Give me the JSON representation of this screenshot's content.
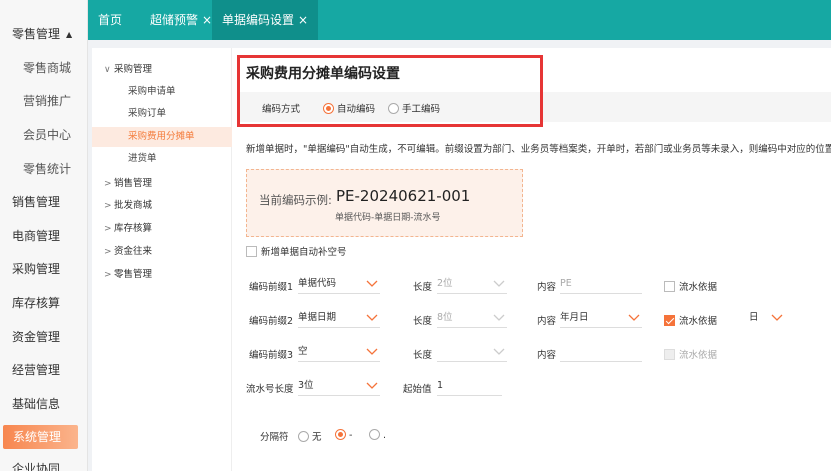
{
  "sidebar": {
    "items": [
      {
        "label": "零售管理",
        "expanded": true
      },
      {
        "label": "零售商城"
      },
      {
        "label": "营销推广"
      },
      {
        "label": "会员中心"
      },
      {
        "label": "零售统计"
      },
      {
        "label": "销售管理"
      },
      {
        "label": "电商管理"
      },
      {
        "label": "采购管理"
      },
      {
        "label": "库存核算"
      },
      {
        "label": "资金管理"
      },
      {
        "label": "经营管理"
      },
      {
        "label": "基础信息"
      },
      {
        "label": "系统管理"
      },
      {
        "label": "企业协同"
      }
    ]
  },
  "tabs": [
    {
      "label": "首页"
    },
    {
      "label": "超储预警",
      "close": "×"
    },
    {
      "label": "单据编码设置",
      "close": "×"
    }
  ],
  "tree": {
    "items": [
      {
        "label": "采购管理",
        "caret": "∨"
      },
      {
        "label": "采购申请单"
      },
      {
        "label": "采购订单"
      },
      {
        "label": "采购费用分摊单"
      },
      {
        "label": "进货单"
      },
      {
        "label": "销售管理",
        "caret": ">"
      },
      {
        "label": "批发商城",
        "caret": ">"
      },
      {
        "label": "库存核算",
        "caret": ">"
      },
      {
        "label": "资金往来",
        "caret": ">"
      },
      {
        "label": "零售管理",
        "caret": ">"
      }
    ]
  },
  "main": {
    "title": "采购费用分摊单编码设置",
    "mode_label": "编码方式",
    "mode_auto": "自动编码",
    "mode_manual": "手工编码",
    "note": "新增单据时，\"单据编码\"自动生成，不可编辑。前缀设置为部门、业务员等档案类，开单时，若部门或业务员等未录入，则编码中对应的位置自动",
    "example_label": "当前编码示例:",
    "example_code": "PE-20240621-001",
    "example_hint": "单据代码-单据日期-流水号",
    "autofill_label": "新增单据自动补空号",
    "prefix_rows": [
      {
        "label": "编码前缀1",
        "value": "单据代码",
        "len_label": "长度",
        "len_value": "2位",
        "content_label": "内容",
        "content_value": "PE",
        "flow_label": "流水依据"
      },
      {
        "label": "编码前缀2",
        "value": "单据日期",
        "len_label": "长度",
        "len_value": "8位",
        "content_label": "内容",
        "content_value": "年月日",
        "flow_label": "流水依据",
        "flow_unit": "日"
      },
      {
        "label": "编码前缀3",
        "value": "空",
        "len_label": "长度",
        "len_value": "",
        "content_label": "内容",
        "content_value": "",
        "flow_label": "流水依据"
      }
    ],
    "serial": {
      "label": "流水号长度",
      "value": "3位",
      "start_label": "起始值",
      "start_value": "1"
    },
    "separator": {
      "label": "分隔符",
      "opt_none": "无",
      "opt_dash": "-",
      "opt_dot": "."
    },
    "colors": {
      "teal": "#16a8a3",
      "orange": "#f5733a",
      "highlight_red": "#e63535"
    }
  }
}
